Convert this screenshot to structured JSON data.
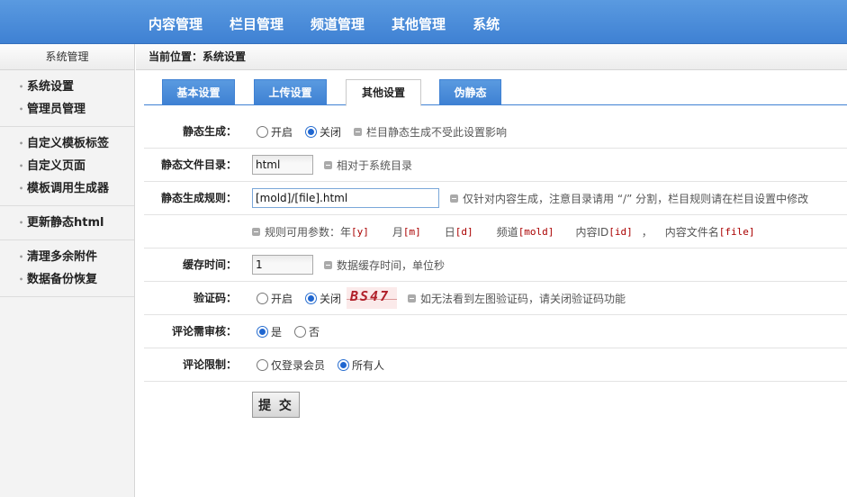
{
  "topnav": [
    "内容管理",
    "栏目管理",
    "频道管理",
    "其他管理",
    "系统"
  ],
  "sidebar": {
    "title": "系统管理",
    "groups": [
      [
        "系统设置",
        "管理员管理"
      ],
      [
        "自定义模板标签",
        "自定义页面",
        "模板调用生成器"
      ],
      [
        "更新静态html"
      ],
      [
        "清理多余附件",
        "数据备份恢复"
      ]
    ]
  },
  "breadcrumb": "当前位置：系统设置",
  "tabs": {
    "items": [
      "基本设置",
      "上传设置",
      "其他设置",
      "伪静态"
    ],
    "active": "其他设置"
  },
  "form": {
    "static_gen": {
      "label": "静态生成：",
      "opt_on": "开启",
      "opt_off": "关闭",
      "selected": "关闭",
      "tip": "栏目静态生成不受此设置影响"
    },
    "static_dir": {
      "label": "静态文件目录：",
      "value": "html",
      "tip": "相对于系统目录"
    },
    "static_rule": {
      "label": "静态生成规则：",
      "value": "[mold]/[file].html",
      "tip": "仅针对内容生成，注意目录请用 “/” 分割，栏目规则请在栏目设置中修改"
    },
    "rule_params": {
      "intro": "规则可用参数：年",
      "year": "[y]",
      "month_label": "月",
      "month": "[m]",
      "day_label": "日",
      "day": "[d]",
      "channel_label": "频道",
      "channel": "[mold]",
      "id_label": "内容ID",
      "id": "[id]",
      "comma": "，",
      "file_label": "内容文件名",
      "file": "[file]"
    },
    "cache": {
      "label": "缓存时间：",
      "value": "1",
      "tip": "数据缓存时间，单位秒"
    },
    "captcha": {
      "label": "验证码：",
      "opt_on": "开启",
      "opt_off": "关闭",
      "selected": "关闭",
      "image_text": "BS47",
      "tip": "如无法看到左图验证码，请关闭验证码功能"
    },
    "comment_review": {
      "label": "评论需审核：",
      "opt_yes": "是",
      "opt_no": "否",
      "selected": "是"
    },
    "comment_limit": {
      "label": "评论限制：",
      "opt_member": "仅登录会员",
      "opt_all": "所有人",
      "selected": "所有人"
    },
    "submit_label": "提 交"
  },
  "colors": {
    "header_blue": "#3f81d3",
    "param_red": "#aa0000"
  }
}
